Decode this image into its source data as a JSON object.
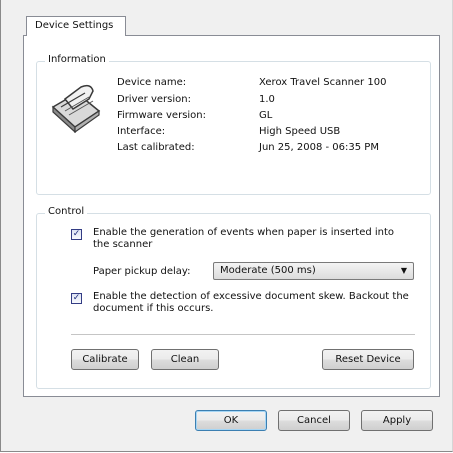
{
  "tab": {
    "label": "Device Settings"
  },
  "information": {
    "title": "Information",
    "rows": [
      {
        "label": "Device name:",
        "value": "Xerox Travel Scanner 100"
      },
      {
        "label": "Driver version:",
        "value": "1.0"
      },
      {
        "label": "Firmware version:",
        "value": "GL"
      },
      {
        "label": "Interface:",
        "value": "High Speed USB"
      },
      {
        "label": "Last calibrated:",
        "value": "Jun 25, 2008 - 06:35 PM"
      }
    ]
  },
  "control": {
    "title": "Control",
    "events_checkbox": {
      "checked": true,
      "mark": "✓",
      "label": "Enable the generation of events when paper is inserted into the scanner"
    },
    "pickup_delay": {
      "label": "Paper pickup delay:",
      "value": "Moderate (500 ms)",
      "arrow": "▼"
    },
    "skew_checkbox": {
      "checked": true,
      "mark": "✓",
      "label": "Enable the detection of excessive document skew. Backout the document if this occurs."
    },
    "buttons": {
      "calibrate": "Calibrate",
      "clean": "Clean",
      "reset": "Reset Device"
    }
  },
  "footer": {
    "ok": "OK",
    "cancel": "Cancel",
    "apply": "Apply"
  },
  "icons": {
    "scanner": "scanner-icon",
    "dropdown": "chevron-down-icon",
    "check": "checkmark-icon"
  }
}
